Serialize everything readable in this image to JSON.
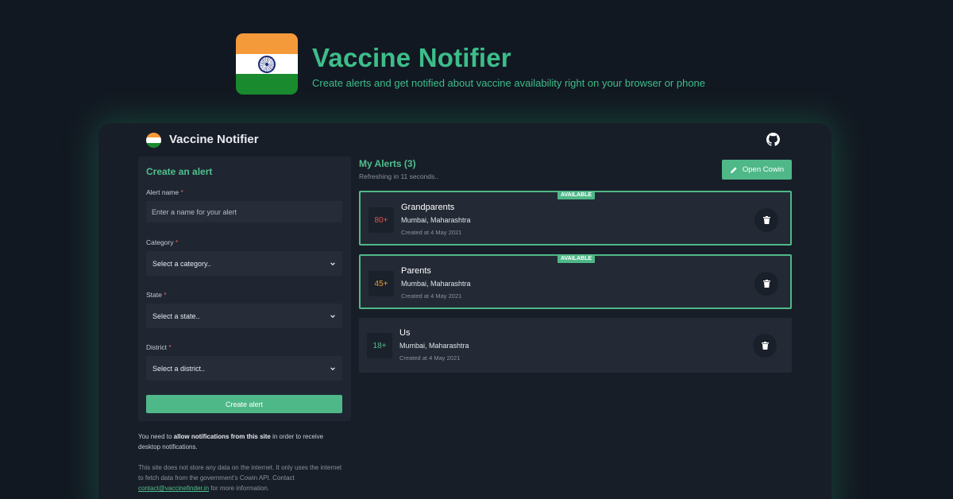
{
  "hero": {
    "title": "Vaccine Notifier",
    "subtitle": "Create alerts and get notified about vaccine availability right on your browser or phone",
    "logo_icon": "india-flag-icon"
  },
  "navbar": {
    "title": "Vaccine Notifier",
    "logo_icon": "india-flag-icon",
    "github_icon": "github-icon"
  },
  "form": {
    "heading": "Create an alert",
    "alert_name_label": "Alert name",
    "alert_name_placeholder": "Enter a name for your alert",
    "category_label": "Category",
    "category_value": "Select a category..",
    "state_label": "State",
    "state_value": "Select a state..",
    "district_label": "District",
    "district_value": "Select a district..",
    "submit_label": "Create alert"
  },
  "notes": {
    "notif_prefix": "You need to ",
    "notif_bold": "allow notifications from this site",
    "notif_suffix": " in order to receive desktop notifications.",
    "privacy_text": "This site does not store any data on the internet. It only uses the internet to fetch data from the government's Cowin API. Contact ",
    "contact_email": "contact@vaccinefinder.in",
    "privacy_suffix": " for more information."
  },
  "alerts": {
    "heading": "My Alerts (3)",
    "refresh_text": "Refreshing in 11 seconds..",
    "open_cowin_label": "Open Cowin",
    "items": [
      {
        "age": "80+",
        "age_color": "#e0544f",
        "name": "Grandparents",
        "location": "Mumbai, Maharashtra",
        "created": "Created at 4 May 2021",
        "badge": "AVAILABLE"
      },
      {
        "age": "45+",
        "age_color": "#e39a3b",
        "name": "Parents",
        "location": "Mumbai, Maharashtra",
        "created": "Created at 4 May 2021",
        "badge": "AVAILABLE"
      },
      {
        "age": "18+",
        "age_color": "#4fbf8d",
        "name": "Us",
        "location": "Mumbai, Maharashtra",
        "created": "Created at 4 May 2021",
        "badge": ""
      }
    ]
  },
  "colors": {
    "accent": "#4fb888",
    "background": "#121821",
    "panel": "#1f2631"
  }
}
